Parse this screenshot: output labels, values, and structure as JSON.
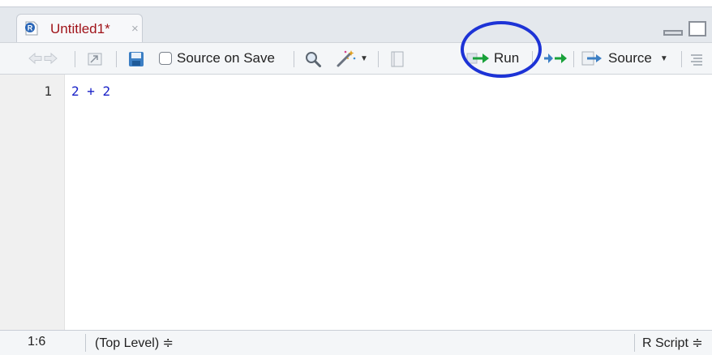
{
  "tab": {
    "title": "Untitled1*",
    "close": "×",
    "icon": "r-file-icon"
  },
  "toolbar": {
    "source_on_save_label": "Source on Save",
    "run_label": "Run",
    "source_label": "Source"
  },
  "editor": {
    "lines": [
      {
        "number": "1",
        "code": "2 + 2"
      }
    ]
  },
  "status": {
    "cursor_position": "1:6",
    "scope": "(Top Level) ≑",
    "file_type": "R Script ≑"
  },
  "colors": {
    "tab_title": "#a0141a",
    "code_text": "#1a22c8",
    "arrow_green": "#19a13a",
    "annotation_circle": "#1d33d6"
  }
}
